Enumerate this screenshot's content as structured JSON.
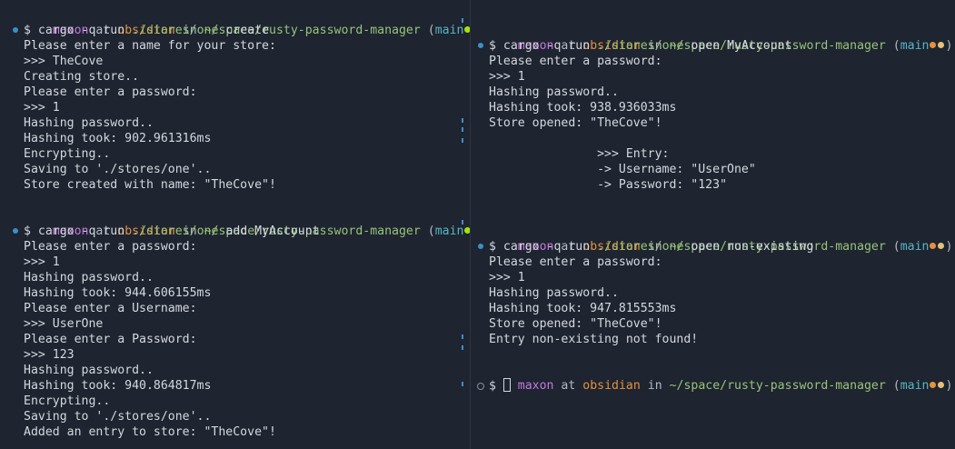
{
  "prompt": {
    "user": "maxon",
    "at": "at",
    "host": "obsidian",
    "in": "in",
    "path": "~/space/rusty-password-manager",
    "branch": "main",
    "dollar": "$"
  },
  "left": {
    "block1": {
      "cmd": "cargo -q run",
      "cmd_path": "./stores/one",
      "cmd_arg": "create",
      "output": [
        "Please enter a name for your store:",
        ">>> TheCove",
        "Creating store..",
        "Please enter a password:",
        ">>> 1",
        "Hashing password..",
        "Hashing took: 902.961316ms",
        "Encrypting..",
        "Saving to './stores/one'..",
        "Store created with name: \"TheCove\"!"
      ]
    },
    "block2": {
      "cmd": "cargo -q run",
      "cmd_path": "./stores/one",
      "cmd_arg": "add MyAccount",
      "output": [
        "Please enter a password:",
        ">>> 1",
        "Hashing password..",
        "Hashing took: 944.606155ms",
        "Please enter a Username:",
        ">>> UserOne",
        "Please enter a Password:",
        ">>> 123",
        "Hashing password..",
        "Hashing took: 940.864817ms",
        "Encrypting..",
        "Saving to './stores/one'..",
        "Added an entry to store: \"TheCove\"!"
      ]
    }
  },
  "right": {
    "block1": {
      "cmd": "cargo -q run",
      "cmd_path": "./stores/one",
      "cmd_arg": "open MyAccount",
      "output": [
        "Please enter a password:",
        ">>> 1",
        "Hashing password..",
        "Hashing took: 938.936033ms",
        "Store opened: \"TheCove\"!",
        "",
        "               >>> Entry:",
        "               -> Username: \"UserOne\"",
        "               -> Password: \"123\""
      ]
    },
    "block2": {
      "cmd": "cargo -q run",
      "cmd_path": "./stores/one",
      "cmd_arg": "open non-existing",
      "output": [
        "Please enter a password:",
        ">>> 1",
        "Hashing password..",
        "Hashing took: 947.815553ms",
        "Store opened: \"TheCove\"!",
        "Entry non-existing not found!"
      ]
    }
  },
  "colors": {
    "background": "#1e2430",
    "prompt_dot_success": "#3b8fc8",
    "branch_dot_green": "#a8e10c",
    "branch_dot_orange": "#e5913f",
    "branch_dot_yellow": "#e5c07b"
  }
}
